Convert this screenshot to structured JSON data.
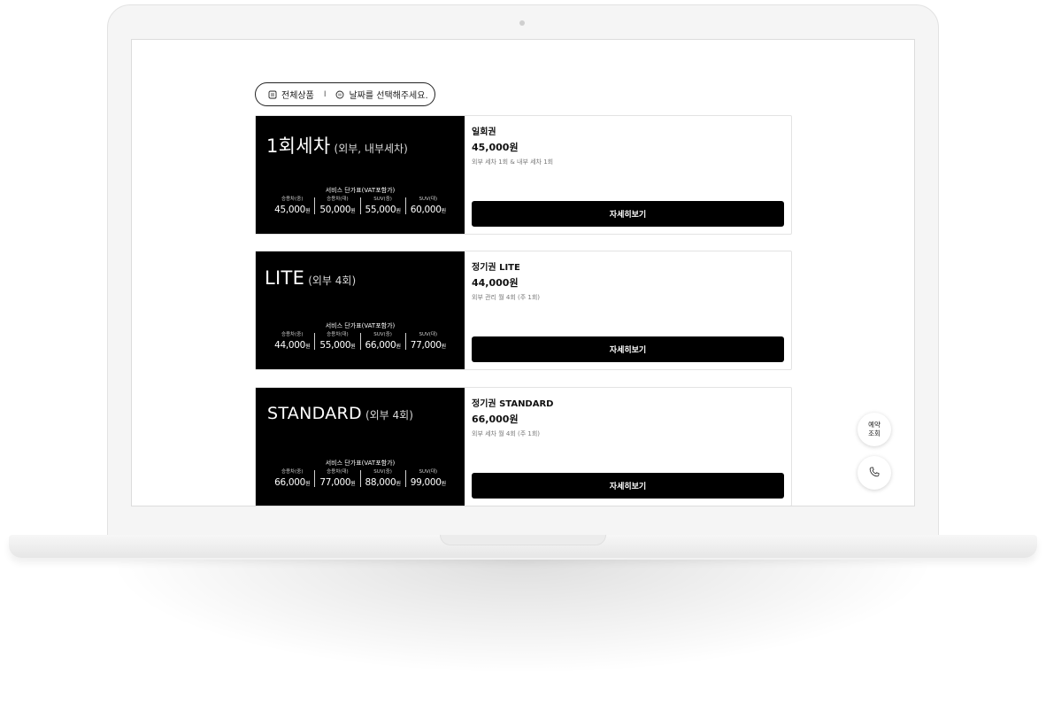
{
  "filter": {
    "all_products_label": "전체상품",
    "separator": "I",
    "date_placeholder": "날짜를 선택해주세요.",
    "all_products_icon": "list-icon",
    "date_icon": "calendar-icon"
  },
  "price_table_title": "서비스 단가표(VAT포함가)",
  "won_unit": "원",
  "cards": [
    {
      "title": "1회세차",
      "subtitle": "(외부, 내부세차)",
      "prices": [
        {
          "label": "승용차(중)",
          "value": "45,000"
        },
        {
          "label": "승용차(대)",
          "value": "50,000"
        },
        {
          "label": "SUV(중)",
          "value": "55,000"
        },
        {
          "label": "SUV(대)",
          "value": "60,000"
        }
      ],
      "product_name": "일회권",
      "product_price": "45,000원",
      "description": "외부 세차 1회 & 내부 세차 1회",
      "button_label": "자세히보기"
    },
    {
      "title": "LITE",
      "subtitle": "(외부 4회)",
      "prices": [
        {
          "label": "승용차(중)",
          "value": "44,000"
        },
        {
          "label": "승용차(대)",
          "value": "55,000"
        },
        {
          "label": "SUV(중)",
          "value": "66,000"
        },
        {
          "label": "SUV(대)",
          "value": "77,000"
        }
      ],
      "product_name": "정기권 LITE",
      "product_price": "44,000원",
      "description": "외부 관리 월 4회 (주 1회)",
      "button_label": "자세히보기"
    },
    {
      "title": "STANDARD",
      "subtitle": "(외부 4회)",
      "prices": [
        {
          "label": "승용차(중)",
          "value": "66,000"
        },
        {
          "label": "승용차(대)",
          "value": "77,000"
        },
        {
          "label": "SUV(중)",
          "value": "88,000"
        },
        {
          "label": "SUV(대)",
          "value": "99,000"
        }
      ],
      "product_name": "정기권 STANDARD",
      "product_price": "66,000원",
      "description": "외부 세차 월 4회 (주 1회)",
      "button_label": "자세히보기"
    }
  ],
  "floating": {
    "reserve_line1": "예약",
    "reserve_line2": "조회",
    "call_icon": "phone-icon"
  }
}
